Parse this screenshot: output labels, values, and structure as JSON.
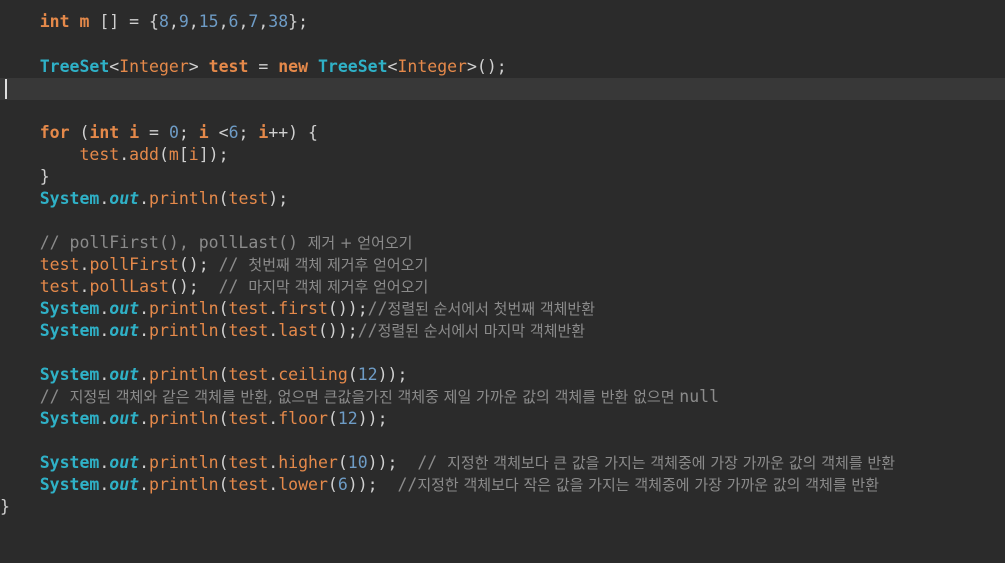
{
  "editor": {
    "lines": [
      {
        "indent": "    ",
        "tokens": [
          {
            "t": "int",
            "c": "kw"
          },
          {
            "t": " ",
            "c": "pl"
          },
          {
            "t": "m",
            "c": "var"
          },
          {
            "t": " [] = {",
            "c": "pl"
          },
          {
            "t": "8",
            "c": "num"
          },
          {
            "t": ",",
            "c": "pl"
          },
          {
            "t": "9",
            "c": "num"
          },
          {
            "t": ",",
            "c": "pl"
          },
          {
            "t": "15",
            "c": "num"
          },
          {
            "t": ",",
            "c": "pl"
          },
          {
            "t": "6",
            "c": "num"
          },
          {
            "t": ",",
            "c": "pl"
          },
          {
            "t": "7",
            "c": "num"
          },
          {
            "t": ",",
            "c": "pl"
          },
          {
            "t": "38",
            "c": "num"
          },
          {
            "t": "};",
            "c": "pl"
          }
        ]
      },
      {
        "indent": "",
        "tokens": []
      },
      {
        "indent": "    ",
        "tokens": [
          {
            "t": "TreeSet",
            "c": "ty"
          },
          {
            "t": "<",
            "c": "pl"
          },
          {
            "t": "Integer",
            "c": "mth"
          },
          {
            "t": "> ",
            "c": "pl"
          },
          {
            "t": "test",
            "c": "var"
          },
          {
            "t": " = ",
            "c": "pl"
          },
          {
            "t": "new",
            "c": "kw"
          },
          {
            "t": " ",
            "c": "pl"
          },
          {
            "t": "TreeSet",
            "c": "ty"
          },
          {
            "t": "<",
            "c": "pl"
          },
          {
            "t": "Integer",
            "c": "mth"
          },
          {
            "t": ">();",
            "c": "pl"
          }
        ]
      },
      {
        "indent": "",
        "tokens": [],
        "current": true
      },
      {
        "indent": "",
        "tokens": []
      },
      {
        "indent": "    ",
        "tokens": [
          {
            "t": "for",
            "c": "kw"
          },
          {
            "t": " (",
            "c": "pl"
          },
          {
            "t": "int",
            "c": "kw"
          },
          {
            "t": " ",
            "c": "pl"
          },
          {
            "t": "i",
            "c": "var"
          },
          {
            "t": " = ",
            "c": "pl"
          },
          {
            "t": "0",
            "c": "num"
          },
          {
            "t": "; ",
            "c": "pl"
          },
          {
            "t": "i",
            "c": "var"
          },
          {
            "t": " <",
            "c": "pl"
          },
          {
            "t": "6",
            "c": "num"
          },
          {
            "t": "; ",
            "c": "pl"
          },
          {
            "t": "i",
            "c": "var"
          },
          {
            "t": "++) {",
            "c": "pl"
          }
        ]
      },
      {
        "indent": "        ",
        "tokens": [
          {
            "t": "test",
            "c": "mth"
          },
          {
            "t": ".",
            "c": "pl"
          },
          {
            "t": "add",
            "c": "mth"
          },
          {
            "t": "(",
            "c": "pl"
          },
          {
            "t": "m",
            "c": "mth"
          },
          {
            "t": "[",
            "c": "pl"
          },
          {
            "t": "i",
            "c": "mth"
          },
          {
            "t": "]);",
            "c": "pl"
          }
        ]
      },
      {
        "indent": "    ",
        "tokens": [
          {
            "t": "}",
            "c": "pl"
          }
        ]
      },
      {
        "indent": "    ",
        "tokens": [
          {
            "t": "System",
            "c": "ty"
          },
          {
            "t": ".",
            "c": "pl"
          },
          {
            "t": "out",
            "c": "fld"
          },
          {
            "t": ".",
            "c": "pl"
          },
          {
            "t": "println",
            "c": "mth"
          },
          {
            "t": "(",
            "c": "pl"
          },
          {
            "t": "test",
            "c": "mth"
          },
          {
            "t": ");",
            "c": "pl"
          }
        ]
      },
      {
        "indent": "",
        "tokens": []
      },
      {
        "indent": "    ",
        "tokens": [
          {
            "t": "// pollFirst(), pollLast()",
            "c": "cmm"
          },
          {
            "t": "  제거 + 얻어오기",
            "c": "cm"
          }
        ]
      },
      {
        "indent": "    ",
        "tokens": [
          {
            "t": "test",
            "c": "mth"
          },
          {
            "t": ".",
            "c": "pl"
          },
          {
            "t": "pollFirst",
            "c": "mth"
          },
          {
            "t": "(); ",
            "c": "pl"
          },
          {
            "t": "// ",
            "c": "cmm"
          },
          {
            "t": "첫번째 객체 제거후 얻어오기",
            "c": "cm"
          }
        ]
      },
      {
        "indent": "    ",
        "tokens": [
          {
            "t": "test",
            "c": "mth"
          },
          {
            "t": ".",
            "c": "pl"
          },
          {
            "t": "pollLast",
            "c": "mth"
          },
          {
            "t": "();  ",
            "c": "pl"
          },
          {
            "t": "// ",
            "c": "cmm"
          },
          {
            "t": "마지막 객체 제거후 얻어오기",
            "c": "cm"
          }
        ]
      },
      {
        "indent": "    ",
        "tokens": [
          {
            "t": "System",
            "c": "ty"
          },
          {
            "t": ".",
            "c": "pl"
          },
          {
            "t": "out",
            "c": "fld"
          },
          {
            "t": ".",
            "c": "pl"
          },
          {
            "t": "println",
            "c": "mth"
          },
          {
            "t": "(",
            "c": "pl"
          },
          {
            "t": "test",
            "c": "mth"
          },
          {
            "t": ".",
            "c": "pl"
          },
          {
            "t": "first",
            "c": "mth"
          },
          {
            "t": "());",
            "c": "pl"
          },
          {
            "t": "//",
            "c": "cmm"
          },
          {
            "t": "정렬된 순서에서 첫번째 객체반환",
            "c": "cm"
          }
        ]
      },
      {
        "indent": "    ",
        "tokens": [
          {
            "t": "System",
            "c": "ty"
          },
          {
            "t": ".",
            "c": "pl"
          },
          {
            "t": "out",
            "c": "fld"
          },
          {
            "t": ".",
            "c": "pl"
          },
          {
            "t": "println",
            "c": "mth"
          },
          {
            "t": "(",
            "c": "pl"
          },
          {
            "t": "test",
            "c": "mth"
          },
          {
            "t": ".",
            "c": "pl"
          },
          {
            "t": "last",
            "c": "mth"
          },
          {
            "t": "());",
            "c": "pl"
          },
          {
            "t": "//",
            "c": "cmm"
          },
          {
            "t": "정렬된 순서에서 마지막 객체반환",
            "c": "cm"
          }
        ]
      },
      {
        "indent": "",
        "tokens": []
      },
      {
        "indent": "    ",
        "tokens": [
          {
            "t": "System",
            "c": "ty"
          },
          {
            "t": ".",
            "c": "pl"
          },
          {
            "t": "out",
            "c": "fld"
          },
          {
            "t": ".",
            "c": "pl"
          },
          {
            "t": "println",
            "c": "mth"
          },
          {
            "t": "(",
            "c": "pl"
          },
          {
            "t": "test",
            "c": "mth"
          },
          {
            "t": ".",
            "c": "pl"
          },
          {
            "t": "ceiling",
            "c": "mth"
          },
          {
            "t": "(",
            "c": "pl"
          },
          {
            "t": "12",
            "c": "num"
          },
          {
            "t": "));",
            "c": "pl"
          }
        ]
      },
      {
        "indent": "    ",
        "tokens": [
          {
            "t": "// ",
            "c": "cmm"
          },
          {
            "t": "지정된 객체와 같은 객체를 반환, 없으면 큰값을가진 객체중 제일 가까운 값의 객체를 반환 없으면 ",
            "c": "cm"
          },
          {
            "t": "null",
            "c": "cmm"
          }
        ]
      },
      {
        "indent": "    ",
        "tokens": [
          {
            "t": "System",
            "c": "ty"
          },
          {
            "t": ".",
            "c": "pl"
          },
          {
            "t": "out",
            "c": "fld"
          },
          {
            "t": ".",
            "c": "pl"
          },
          {
            "t": "println",
            "c": "mth"
          },
          {
            "t": "(",
            "c": "pl"
          },
          {
            "t": "test",
            "c": "mth"
          },
          {
            "t": ".",
            "c": "pl"
          },
          {
            "t": "floor",
            "c": "mth"
          },
          {
            "t": "(",
            "c": "pl"
          },
          {
            "t": "12",
            "c": "num"
          },
          {
            "t": "));",
            "c": "pl"
          }
        ]
      },
      {
        "indent": "",
        "tokens": []
      },
      {
        "indent": "    ",
        "tokens": [
          {
            "t": "System",
            "c": "ty"
          },
          {
            "t": ".",
            "c": "pl"
          },
          {
            "t": "out",
            "c": "fld"
          },
          {
            "t": ".",
            "c": "pl"
          },
          {
            "t": "println",
            "c": "mth"
          },
          {
            "t": "(",
            "c": "pl"
          },
          {
            "t": "test",
            "c": "mth"
          },
          {
            "t": ".",
            "c": "pl"
          },
          {
            "t": "higher",
            "c": "mth"
          },
          {
            "t": "(",
            "c": "pl"
          },
          {
            "t": "10",
            "c": "num"
          },
          {
            "t": "));  ",
            "c": "pl"
          },
          {
            "t": "// ",
            "c": "cmm"
          },
          {
            "t": "지정한 객체보다 큰 값을 가지는 객체중에 가장 가까운 값의 객체를 반환",
            "c": "cm"
          }
        ]
      },
      {
        "indent": "    ",
        "tokens": [
          {
            "t": "System",
            "c": "ty"
          },
          {
            "t": ".",
            "c": "pl"
          },
          {
            "t": "out",
            "c": "fld"
          },
          {
            "t": ".",
            "c": "pl"
          },
          {
            "t": "println",
            "c": "mth"
          },
          {
            "t": "(",
            "c": "pl"
          },
          {
            "t": "test",
            "c": "mth"
          },
          {
            "t": ".",
            "c": "pl"
          },
          {
            "t": "lower",
            "c": "mth"
          },
          {
            "t": "(",
            "c": "pl"
          },
          {
            "t": "6",
            "c": "num"
          },
          {
            "t": "));  ",
            "c": "pl"
          },
          {
            "t": "//",
            "c": "cmm"
          },
          {
            "t": "지정한 객체보다 작은 값을 가지는 객체중에 가장 가까운 값의 객체를 반환",
            "c": "cm"
          }
        ]
      },
      {
        "indent": "",
        "tokens": [
          {
            "t": "}",
            "c": "pl"
          }
        ]
      }
    ]
  }
}
